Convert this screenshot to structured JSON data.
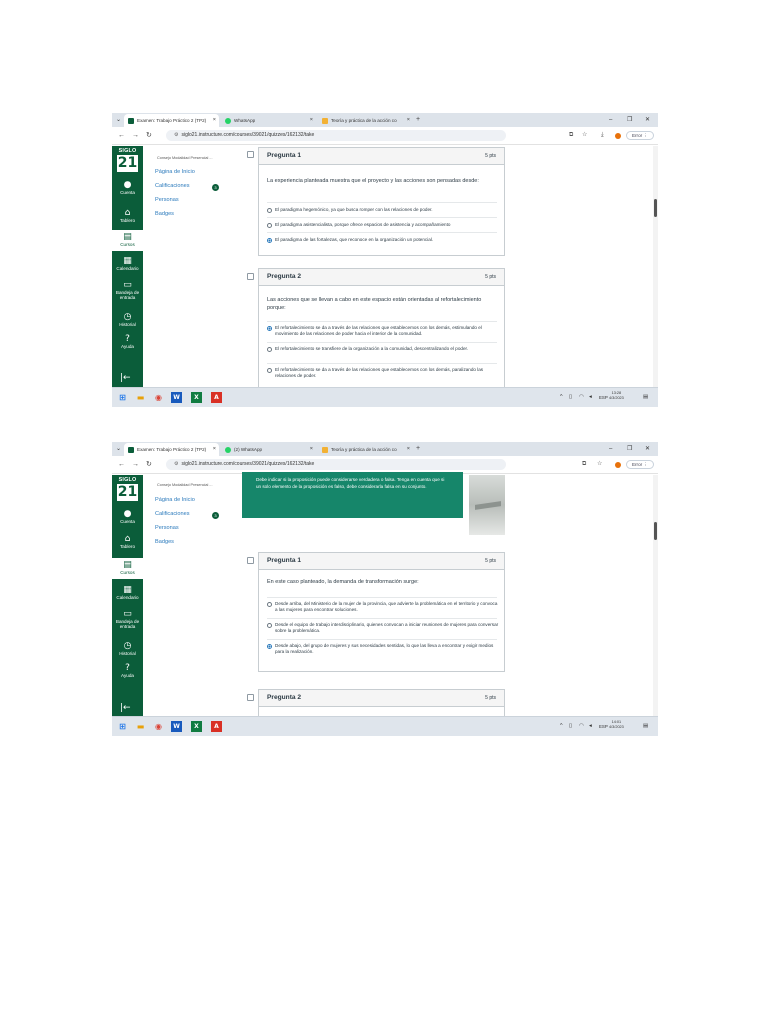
{
  "shots": [
    {
      "tabs": [
        {
          "label": "Examen: Trabajo Práctico 2 (TP2)",
          "close": "×"
        },
        {
          "label": "WhatsApp",
          "close": "×"
        },
        {
          "label": "Teoría y práctica de la acción co",
          "close": "×"
        }
      ],
      "url": "siglo21.instructure.com/courses/39021/quizzes/162132/take",
      "error_label": "Error",
      "time": "13:28",
      "date": "4/3/2023",
      "lang": "ESP",
      "course_breadcrumb": "Consejo Modalidad Presencial ...",
      "course_nav": [
        "Página de Inicio",
        "Calificaciones",
        "Personas",
        "Badges"
      ],
      "grades_badge": "3",
      "questions": [
        {
          "title": "Pregunta 1",
          "points": "5 pts",
          "text": "La experiencia planteada muestra que el proyecto y las acciones son pensadas desde:",
          "answers": [
            {
              "text": "El paradigma hegemónico, ya que busca romper con las relaciones de poder.",
              "selected": false
            },
            {
              "text": "El paradigma asistencialista, porque ofrece espacios de asistencia y acompañamiento",
              "selected": false
            },
            {
              "text": "El paradigma de las fortalezas, que reconoce en la organización un potencial.",
              "selected": true
            }
          ]
        },
        {
          "title": "Pregunta 2",
          "points": "5 pts",
          "text": "Las acciones que se llevan a cabo en este espacio están orientadas al refortalecimiento porque:",
          "answers": [
            {
              "text": "El refortalecimiento se da a través de las relaciones que establecemos con los demás, estimulando el movimiento de las relaciones de poder hacia el interior de la comunidad.",
              "selected": true
            },
            {
              "text": "El refortalecimiento se transfiere de la organización a la comunidad, descentralizando el poder.",
              "selected": false
            },
            {
              "text": "El refortalecimiento se da a través de las relaciones que establecemos con los demás, paralizando las relaciones de poder.",
              "selected": false
            }
          ]
        }
      ]
    },
    {
      "tabs": [
        {
          "label": "Examen: Trabajo Práctico 2 (TP2)",
          "close": "×"
        },
        {
          "label": "(2) WhatsApp",
          "close": "×"
        },
        {
          "label": "Teoría y práctica de la acción co",
          "close": "×"
        }
      ],
      "url": "siglo21.instructure.com/courses/39021/quizzes/162132/take",
      "error_label": "Error",
      "time": "14:01",
      "date": "4/3/2023",
      "lang": "ESP",
      "course_breadcrumb": "Consejo Modalidad Presencial ...",
      "course_nav": [
        "Página de Inicio",
        "Calificaciones",
        "Personas",
        "Badges"
      ],
      "grades_badge": "3",
      "info_text": "Debe indicar si la proposición puede considerarse verdadera o falsa. Tenga en cuenta que si un solo elemento de la proposición es falso, debe considerarla falsa en su conjunto.",
      "questions": [
        {
          "title": "Pregunta 1",
          "points": "5 pts",
          "text": "En este caso planteado, la demanda de transformación surge:",
          "answers": [
            {
              "text": "Desde arriba, del Ministerio de la mujer de la provincia, que advierte la problemática en el territorio y convoca a las mujeres para encontrar soluciones.",
              "selected": false
            },
            {
              "text": "Desde el equipo de trabajo interdisciplinario, quienes convocan a iniciar reuniones de mujeres para conversar sobre la problemática.",
              "selected": false
            },
            {
              "text": "Desde abajo, del grupo de mujeres y sus necesidades sentidas, lo que las lleva a encontrar y exigir medios para la realización.",
              "selected": true
            }
          ]
        },
        {
          "title": "Pregunta 2",
          "points": "5 pts"
        }
      ]
    }
  ],
  "global_nav": {
    "logo_text": "SIGLO",
    "logo_mark": "21",
    "items": [
      "Cuenta",
      "Tablero",
      "Cursos",
      "Calendario",
      "Bandeja de entrada",
      "Historial",
      "Ayuda"
    ]
  },
  "icons": {
    "account": "●",
    "dashboard": "⌂",
    "courses": "▤",
    "calendar": "▦",
    "inbox": "▭",
    "history": "◷",
    "help": "?",
    "collapse": "|←"
  },
  "colors": {
    "canvas_green": "#0b5d3a",
    "info_green": "#16866a",
    "link_blue": "#2b7abc"
  }
}
